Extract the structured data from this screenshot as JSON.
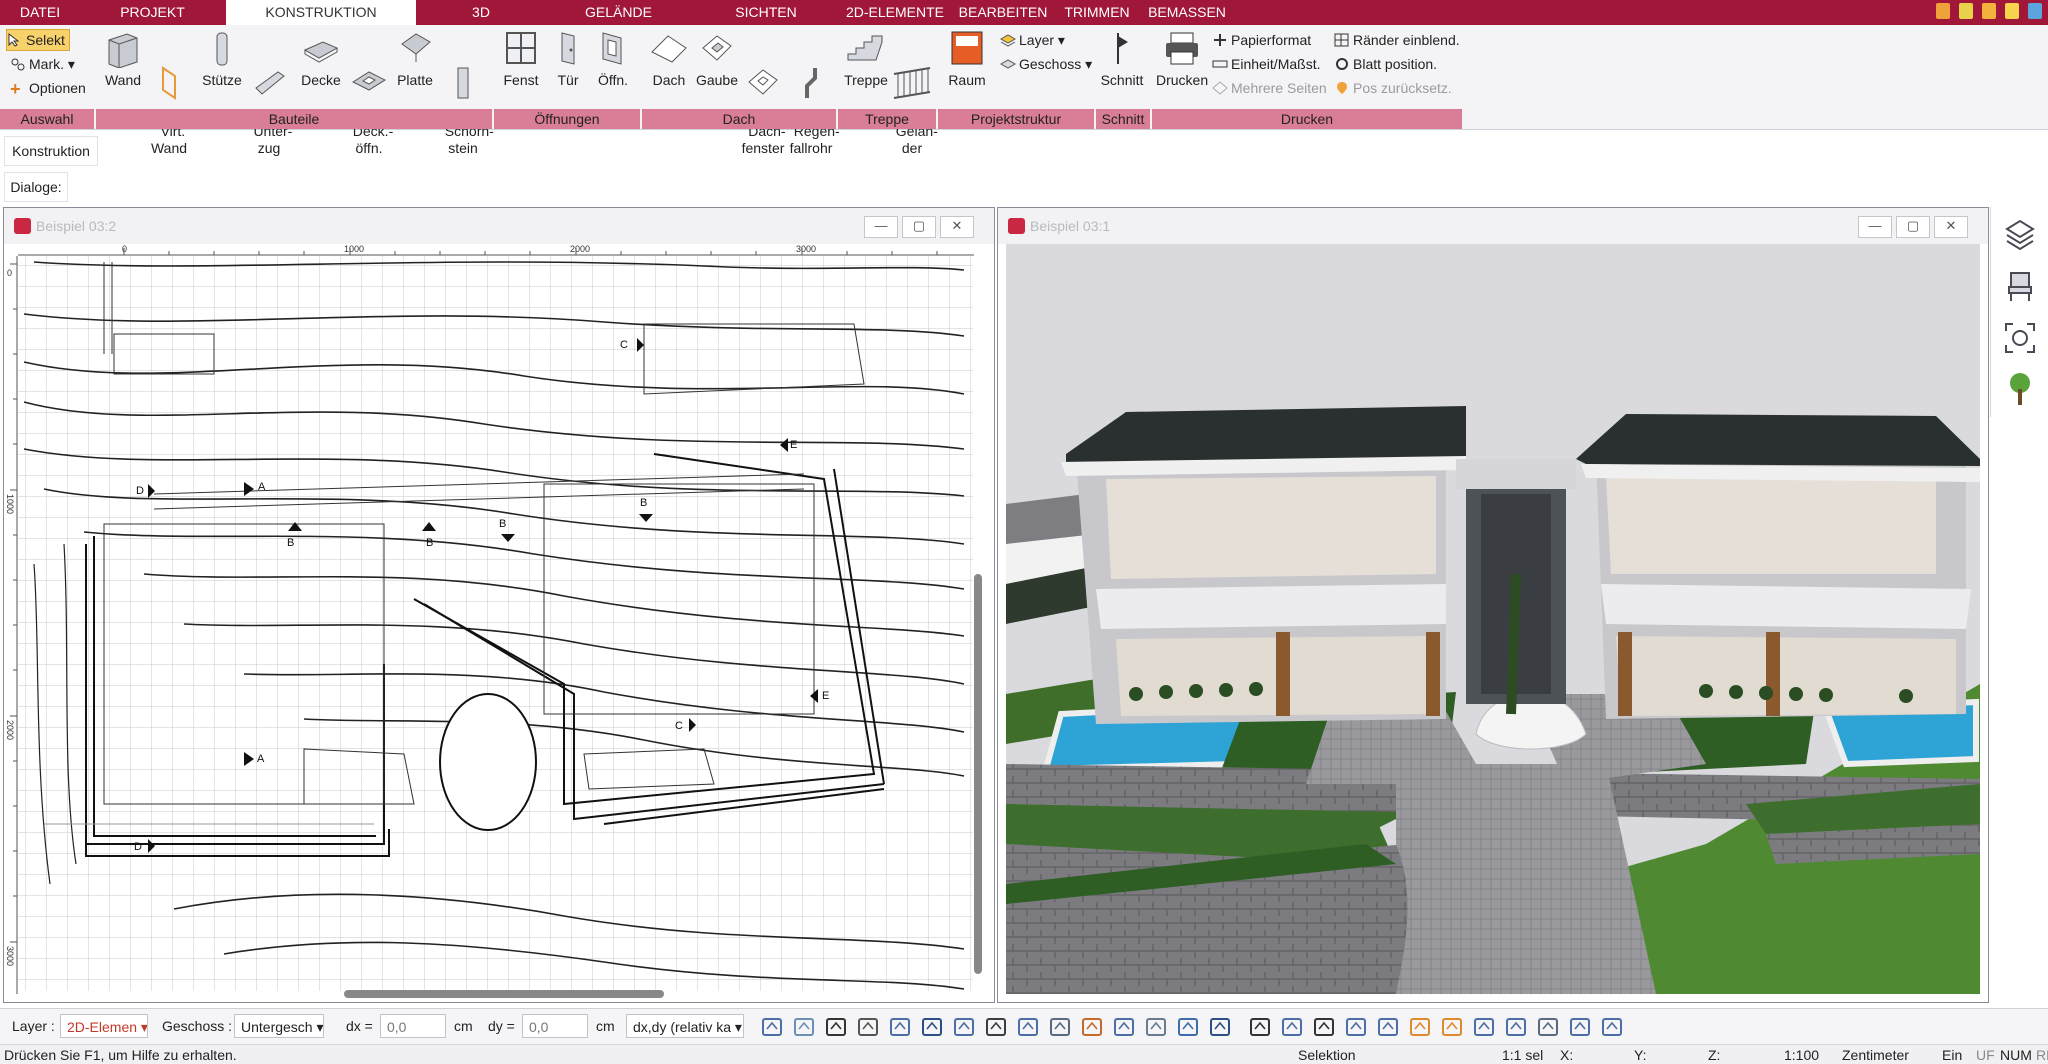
{
  "menu": {
    "tabs": [
      {
        "label": "DATEI",
        "active": false
      },
      {
        "label": "PROJEKT",
        "active": false
      },
      {
        "label": "KONSTRUKTION",
        "active": true
      },
      {
        "label": "3D",
        "active": false
      },
      {
        "label": "GELÄNDE",
        "active": false
      },
      {
        "label": "SICHTEN",
        "active": false
      },
      {
        "label": "2D-ELEMENTE",
        "active": false
      },
      {
        "label": "BEARBEITEN",
        "active": false
      },
      {
        "label": "TRIMMEN",
        "active": false
      },
      {
        "label": "BEMASSEN",
        "active": false
      }
    ],
    "quick_icons": [
      "tools-icon",
      "info-icon",
      "save-icon",
      "help-icon",
      "share-icon"
    ]
  },
  "ribbon": {
    "auswahl": {
      "selekt": "Selekt",
      "mark": "Mark.",
      "optionen": "Optionen",
      "group": "Auswahl"
    },
    "bauteile": {
      "wand": "Wand",
      "virt_wand": "Virt.\nWand",
      "stuetze": "Stütze",
      "unterzug": "Unter-\nzug",
      "decke": "Decke",
      "deck_oeffn": "Deck.-\nöffn.",
      "platte": "Platte",
      "schornstein": "Schorn-\nstein",
      "group": "Bauteile"
    },
    "oeffnungen": {
      "fenst": "Fenst",
      "tuer": "Tür",
      "oeffn": "Öffn.",
      "group": "Öffnungen"
    },
    "dach": {
      "dach": "Dach",
      "gaube": "Gaube",
      "dachfenster": "Dach-\nfenster",
      "regenfallrohr": "Regen-\nfallrohr",
      "group": "Dach"
    },
    "treppe": {
      "treppe": "Treppe",
      "gelaender": "Gelän-\nder",
      "group": "Treppe"
    },
    "projektstruktur": {
      "raum": "Raum",
      "layer": "Layer",
      "geschoss": "Geschoss",
      "group": "Projektstruktur"
    },
    "schnitt": {
      "schnitt": "Schnitt",
      "group": "Schnitt"
    },
    "drucken": {
      "drucken": "Drucken",
      "papierformat": "Papierformat",
      "einheit": "Einheit/Maßst.",
      "mehrere_seiten": "Mehrere Seiten",
      "raender": "Ränder einblend.",
      "blatt": "Blatt position.",
      "pos_zurueck": "Pos zurücksetz.",
      "group": "Drucken"
    }
  },
  "side": {
    "konstruktion_tab": "Konstruktion",
    "dialoge_label": "Dialoge:"
  },
  "windows": {
    "plan": {
      "title": "Beispiel 03:2",
      "ruler_top": [
        "0",
        "1000",
        "2000",
        "3000"
      ],
      "ruler_left": [
        "0",
        "1000",
        "2000",
        "3000"
      ],
      "marks": [
        "A",
        "A",
        "B",
        "B",
        "B",
        "B",
        "C",
        "C",
        "D",
        "D",
        "E",
        "E"
      ]
    },
    "view3d": {
      "title": "Beispiel 03:1"
    }
  },
  "right_toolbar": [
    "layers-icon",
    "chair-icon",
    "zoom-extents-icon",
    "tree-icon"
  ],
  "bottom": {
    "layer_label": "Layer :",
    "layer_value": "2D-Elemen",
    "geschoss_label": "Geschoss :",
    "geschoss_value": "Untergesch",
    "dx_label": "dx =",
    "dx_value": "0,0",
    "dx_unit": "cm",
    "dy_label": "dy =",
    "dy_value": "0,0",
    "dy_unit": "cm",
    "mode_value": "dx,dy (relativ ka",
    "tool_icons": [
      "hatch-icon",
      "fill-icon",
      "line-weight-icon",
      "line-style-icon",
      "dimension-icon",
      "text-icon",
      "measure-icon",
      "snap-icon",
      "frame-icon",
      "object-icon",
      "layer-copy-icon",
      "terrain-icon",
      "terrain2-icon",
      "layer-stack-icon",
      "north-icon",
      "more-icon",
      "window-icon",
      "door-icon",
      "grid-icon",
      "dimension-grid-icon",
      "section-icon",
      "view-icon",
      "move-icon",
      "rotate-icon",
      "raster-icon",
      "snap-grid-icon",
      "fit-icon"
    ]
  },
  "status": {
    "help": "Drücken Sie F1, um Hilfe zu erhalten.",
    "mode": "Selektion",
    "sel": "1:1 sel",
    "x": "X:",
    "y": "Y:",
    "z": "Z:",
    "scale": "1:100",
    "unit": "Zentimeter",
    "ein": "Ein",
    "uf": "UF",
    "num": "NUM",
    "rf": "RF"
  }
}
